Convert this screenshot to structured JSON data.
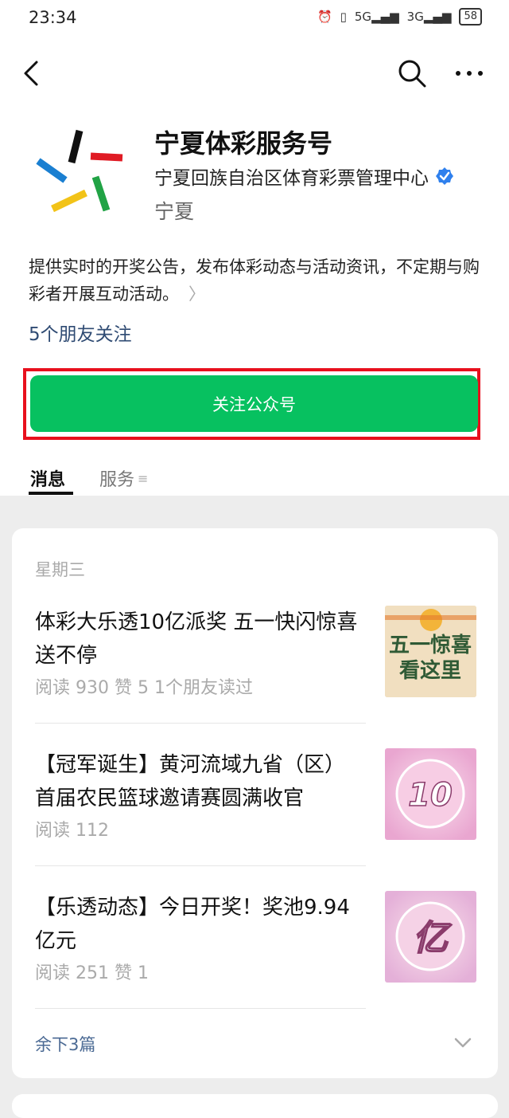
{
  "status_bar": {
    "time": "23:34",
    "signal_1": "5G",
    "signal_2": "3G",
    "battery": "58"
  },
  "nav": {
    "back_icon": "chevron-left-icon",
    "search_icon": "search-icon",
    "more_icon": "more-horizontal-icon"
  },
  "profile": {
    "name": "宁夏体彩服务号",
    "org": "宁夏回族自治区体育彩票管理中心",
    "verified_icon": "verified-badge-icon",
    "region": "宁夏",
    "description": "提供实时的开奖公告，发布体彩动态与活动资讯，不定期与购彩者开展互动活动。",
    "friends_following": "5个朋友关注"
  },
  "follow_button": {
    "label": "关注公众号",
    "color": "#07c160",
    "highlight_color": "#e8101d"
  },
  "tabs": [
    {
      "label": "消息",
      "active": true
    },
    {
      "label": "服务",
      "active": false
    }
  ],
  "feed": {
    "weekday": "星期三",
    "articles": [
      {
        "title": "体彩大乐透10亿派奖 五一快闪惊喜送不停",
        "meta": "阅读 930  赞 5  1个朋友读过",
        "thumb_text_1": "五一惊喜",
        "thumb_text_2": "看这里"
      },
      {
        "title": "【冠军诞生】黄河流域九省（区）首届农民篮球邀请赛圆满收官",
        "meta": "阅读 112",
        "thumb_text_1": "10"
      },
      {
        "title": "【乐透动态】今日开奖！奖池9.94亿元",
        "meta": "阅读 251  赞 1",
        "thumb_text_1": "亿"
      }
    ],
    "more_label": "余下3篇"
  }
}
